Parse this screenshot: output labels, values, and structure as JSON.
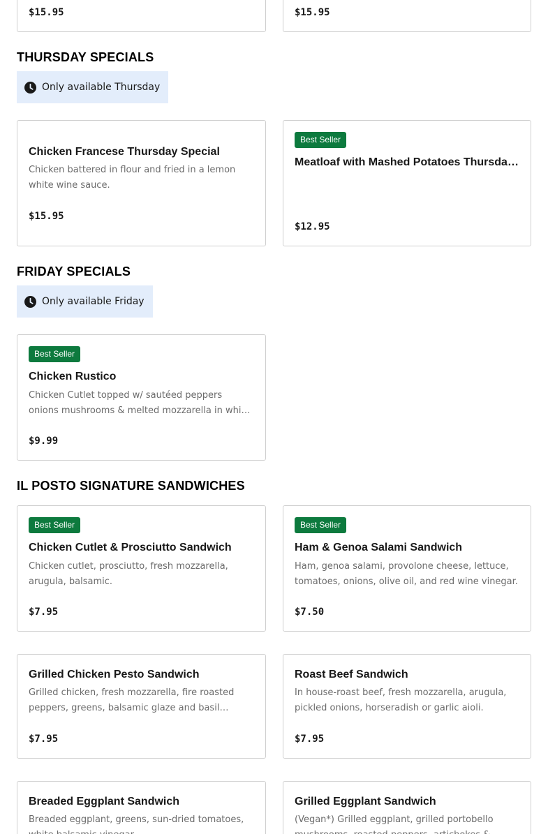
{
  "top_cards": {
    "left_price": "$15.95",
    "right_price": "$15.95"
  },
  "sections": {
    "thursday": {
      "title": "THURSDAY SPECIALS",
      "availability": "Only available Thursday",
      "items": [
        {
          "badge": "",
          "name": "Chicken Francese Thursday Special",
          "description": "Chicken battered in flour and fried in a lemon white wine sauce.",
          "price": "$15.95"
        },
        {
          "badge": "Best Seller",
          "name": "Meatloaf with Mashed Potatoes Thursday...",
          "description": "",
          "price": "$12.95"
        }
      ]
    },
    "friday": {
      "title": "FRIDAY SPECIALS",
      "availability": "Only available Friday",
      "items": [
        {
          "badge": "Best Seller",
          "name": "Chicken Rustico",
          "description": "Chicken Cutlet topped w/ sautéed peppers onions mushrooms & melted mozzarella in white wine.",
          "price": "$9.99"
        }
      ]
    },
    "sandwiches": {
      "title": "IL POSTO SIGNATURE SANDWICHES",
      "items": [
        {
          "badge": "Best Seller",
          "name": "Chicken Cutlet & Prosciutto Sandwich",
          "description": "Chicken cutlet, prosciutto, fresh mozzarella, arugula, balsamic.",
          "price": "$7.95"
        },
        {
          "badge": "Best Seller",
          "name": "Ham & Genoa Salami Sandwich",
          "description": "Ham, genoa salami, provolone cheese, lettuce, tomatoes, onions, olive oil, and red wine vinegar.",
          "price": "$7.50"
        },
        {
          "badge": "",
          "name": "Grilled Chicken Pesto Sandwich",
          "description": "Grilled chicken, fresh mozzarella, fire roasted peppers, greens, balsamic glaze and basil pesto...",
          "price": "$7.95"
        },
        {
          "badge": "",
          "name": "Roast Beef Sandwich",
          "description": "In house-roast beef, fresh mozzarella, arugula, pickled onions, horseradish or garlic aioli.",
          "price": "$7.95"
        },
        {
          "badge": "",
          "name": "Breaded Eggplant Sandwich",
          "description": "Breaded eggplant, greens, sun-dried tomatoes, white balsamic vinegar...",
          "price": ""
        },
        {
          "badge": "",
          "name": "Grilled Eggplant Sandwich",
          "description": "(Vegan*) Grilled eggplant, grilled portobello mushrooms, roasted peppers, artichokes & vegetable...",
          "price": ""
        }
      ]
    }
  },
  "colors": {
    "badge_bg": "#0d7a3e",
    "availability_bg": "#e3edfb"
  },
  "icons": {
    "availability": "clock-icon"
  }
}
